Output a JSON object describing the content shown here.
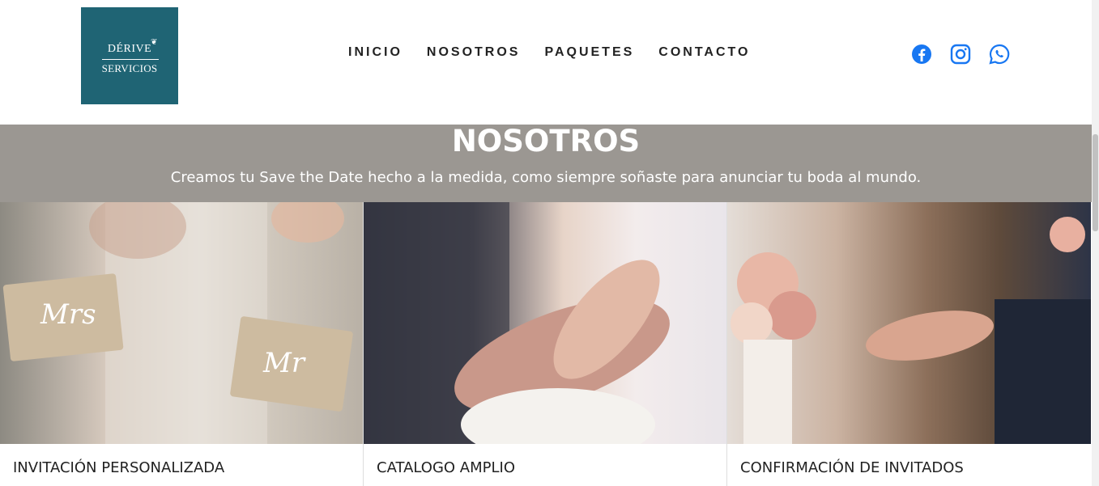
{
  "logo": {
    "line1": "DÉRIVE",
    "line2": "SERVICIOS"
  },
  "nav": {
    "items": [
      "INICIO",
      "NOSOTROS",
      "PAQUETES",
      "CONTACTO"
    ]
  },
  "social": {
    "icons": [
      "facebook-icon",
      "instagram-icon",
      "whatsapp-icon"
    ],
    "color": "#1877f2"
  },
  "banner": {
    "title": "NOSOTROS",
    "subtitle": "Creamos tu Save the Date hecho a la medida, como siempre soñaste para anunciar tu boda al mundo.",
    "background": "#9b9792"
  },
  "cards": [
    {
      "title": "INVITACIÓN PERSONALIZADA",
      "image": "Mrs & Mr wooden signs held by couple",
      "sign1": "Mrs",
      "sign2": "Mr"
    },
    {
      "title": "CATALOGO AMPLIO",
      "image": "couple hands with wedding rings and bouquet"
    },
    {
      "title": "CONFIRMACIÓN DE INVITADOS",
      "image": "bride and groom holding hands with bouquet"
    }
  ],
  "colors": {
    "logo_bg": "#1f6474",
    "nav_text": "#222222"
  }
}
